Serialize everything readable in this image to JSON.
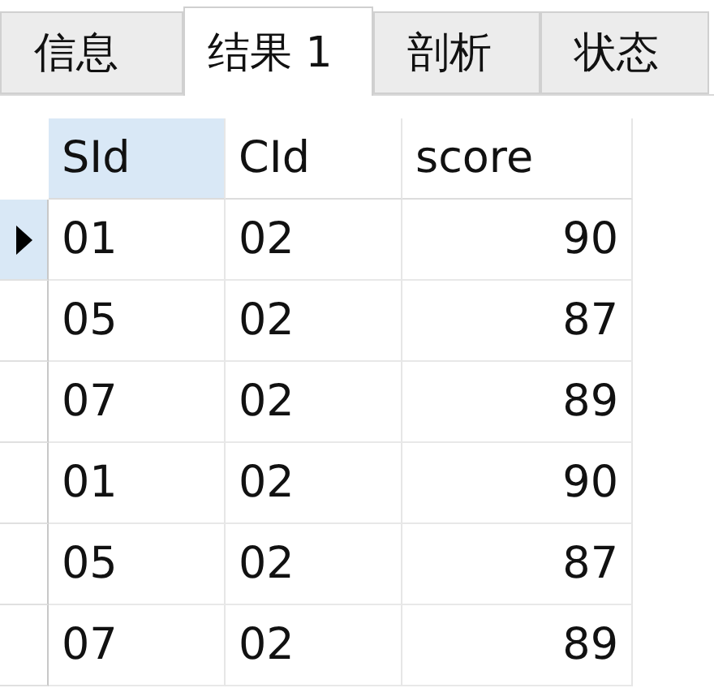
{
  "tabs": [
    {
      "label": "信息",
      "selected": false
    },
    {
      "label": "结果 1",
      "selected": true
    },
    {
      "label": "剖析",
      "selected": false
    },
    {
      "label": "状态",
      "selected": false
    }
  ],
  "table": {
    "columns": [
      {
        "label": "SId",
        "selected": true,
        "kind": "text"
      },
      {
        "label": "CId",
        "selected": false,
        "kind": "text"
      },
      {
        "label": "score",
        "selected": false,
        "kind": "number"
      }
    ],
    "rows": [
      {
        "selected": true,
        "cells": [
          "01",
          "02",
          "90"
        ]
      },
      {
        "selected": false,
        "cells": [
          "05",
          "02",
          "87"
        ]
      },
      {
        "selected": false,
        "cells": [
          "07",
          "02",
          "89"
        ]
      },
      {
        "selected": false,
        "cells": [
          "01",
          "02",
          "90"
        ]
      },
      {
        "selected": false,
        "cells": [
          "05",
          "02",
          "87"
        ]
      },
      {
        "selected": false,
        "cells": [
          "07",
          "02",
          "89"
        ]
      }
    ]
  }
}
